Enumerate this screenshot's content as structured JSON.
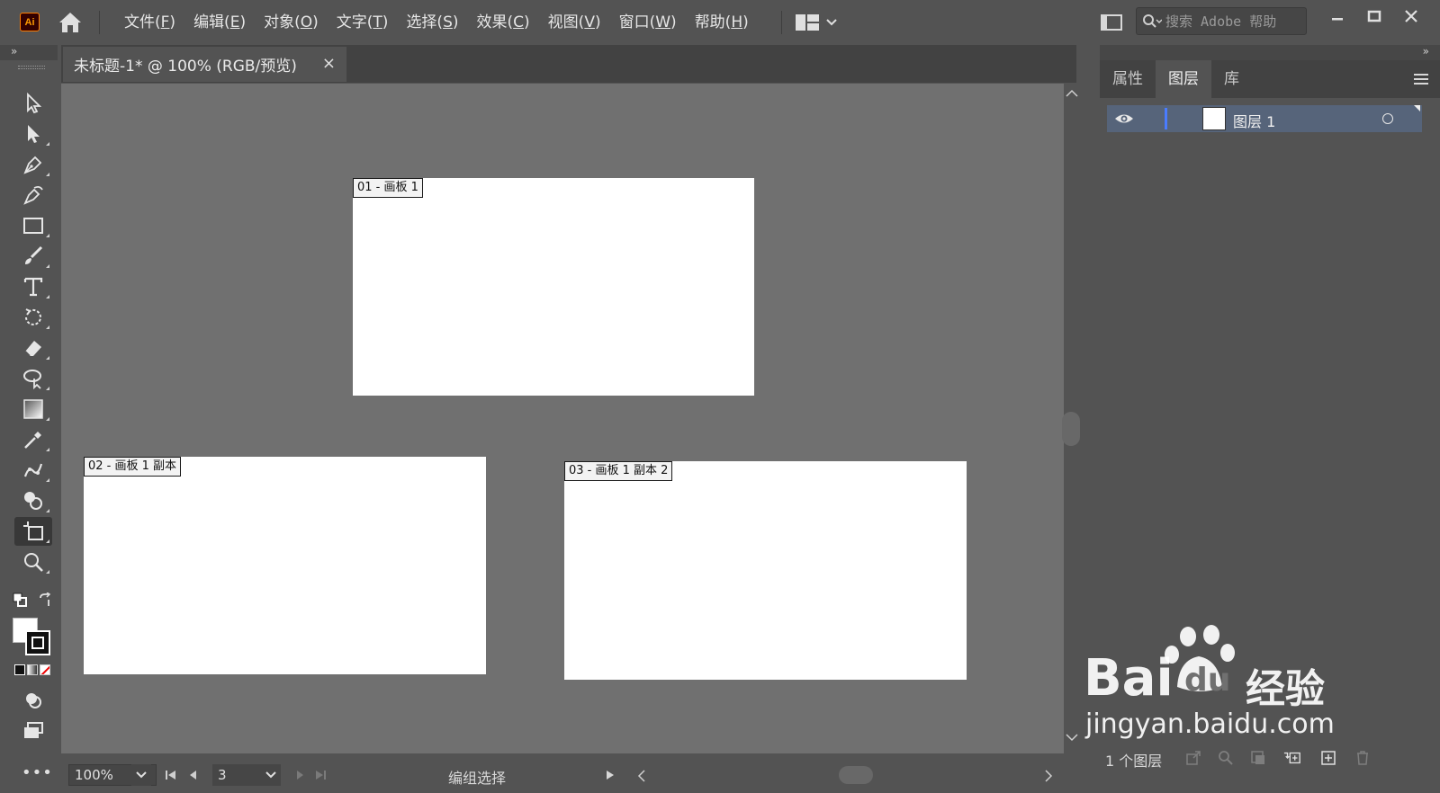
{
  "app": {
    "logo_text": "Ai",
    "accent_color": "#ff7c00"
  },
  "menu": {
    "items": [
      {
        "label": "文件(",
        "key": "F",
        "close": ")"
      },
      {
        "label": "编辑(",
        "key": "E",
        "close": ")"
      },
      {
        "label": "对象(",
        "key": "O",
        "close": ")"
      },
      {
        "label": "文字(",
        "key": "T",
        "close": ")"
      },
      {
        "label": "选择(",
        "key": "S",
        "close": ")"
      },
      {
        "label": "效果(",
        "key": "C",
        "close": ")"
      },
      {
        "label": "视图(",
        "key": "V",
        "close": ")"
      },
      {
        "label": "窗口(",
        "key": "W",
        "close": ")"
      },
      {
        "label": "帮助(",
        "key": "H",
        "close": ")"
      }
    ]
  },
  "search": {
    "placeholder": "搜索 Adobe 帮助"
  },
  "document": {
    "tab_title": "未标题-1* @ 100% (RGB/预览)",
    "close_glyph": "×"
  },
  "artboards": [
    {
      "label": "01 - 画板 1"
    },
    {
      "label": "02 - 画板 1 副本"
    },
    {
      "label": "03 - 画板 1 副本 2"
    }
  ],
  "status": {
    "zoom": "100%",
    "artboard_number": "3",
    "tool_text": "编组选择"
  },
  "right_panel": {
    "tabs": [
      "属性",
      "图层",
      "库"
    ],
    "active_tab": "图层",
    "layers": [
      {
        "name": "图层 1",
        "visible": true,
        "color": "#4a7cff"
      }
    ],
    "layer_count": "1 个图层"
  },
  "watermark": {
    "brand": "Bai",
    "brand2": "du",
    "cn": "经验",
    "url": "jingyan.baidu.com"
  },
  "icons": {
    "tools": [
      "selection-icon",
      "direct-selection-icon",
      "pen-icon",
      "curvature-icon",
      "rectangle-icon",
      "paintbrush-icon",
      "type-icon",
      "rotate-icon",
      "eraser-icon",
      "lasso-icon",
      "gradient-icon",
      "eyedropper-icon",
      "puppet-warp-icon",
      "shape-builder-icon",
      "artboard-icon",
      "zoom-icon"
    ]
  }
}
